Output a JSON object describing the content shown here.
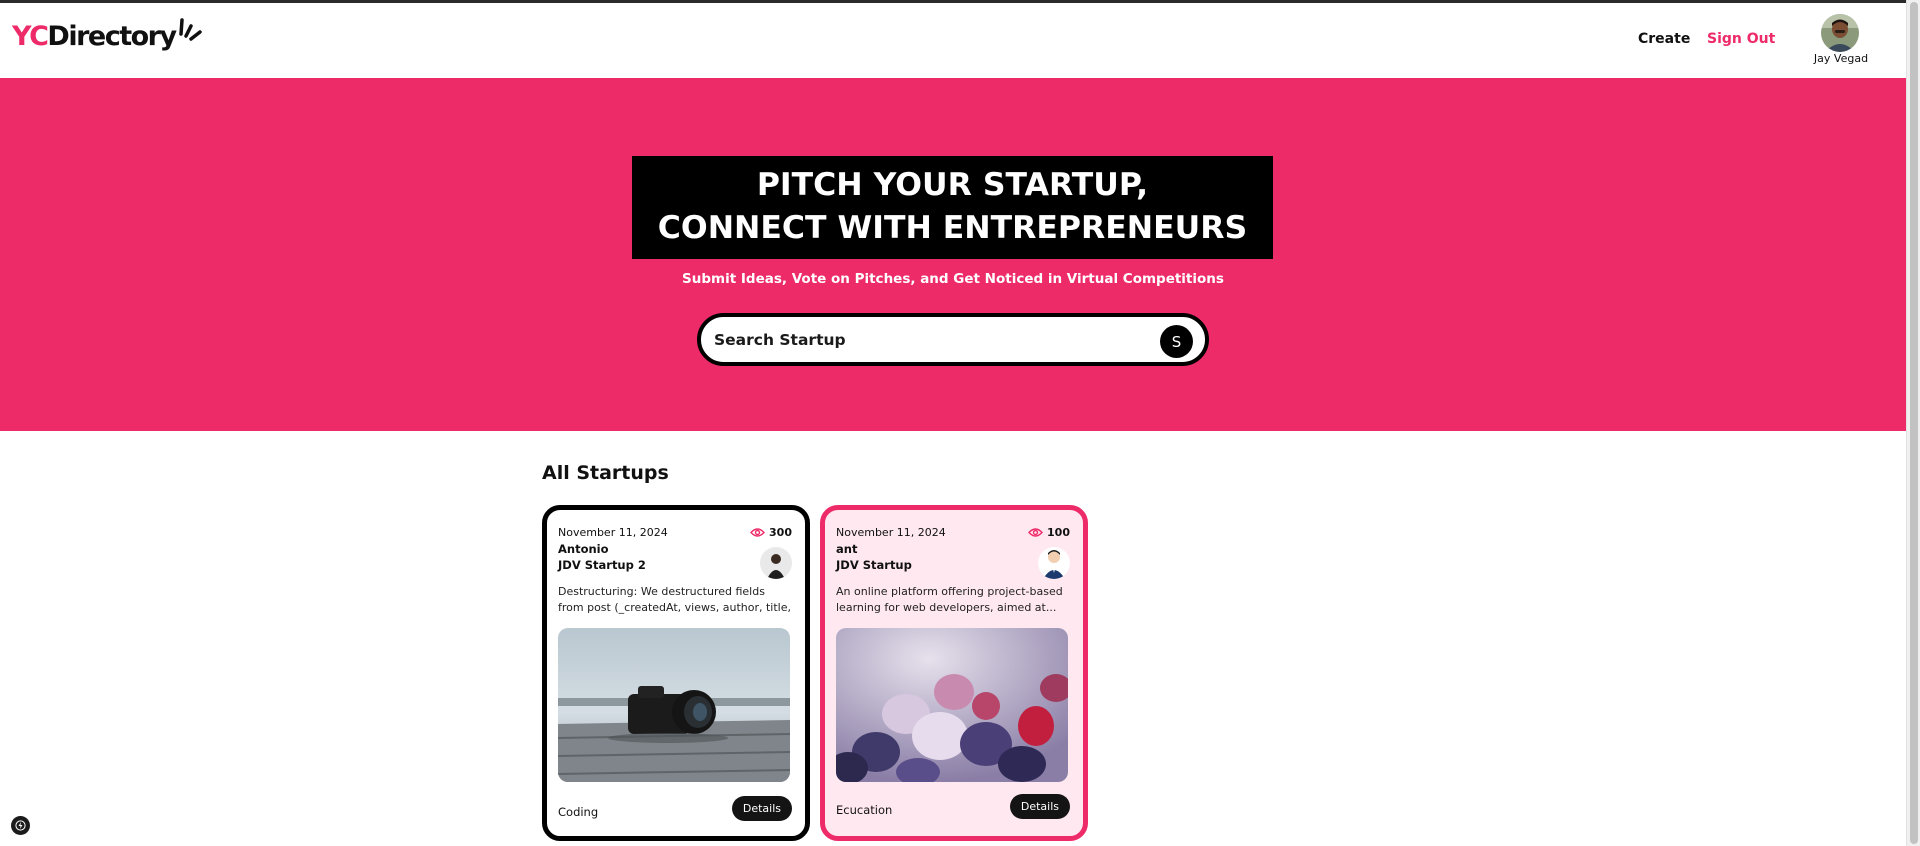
{
  "brand": {
    "part1": "YC",
    "part2": "Directory",
    "accent": "#EE2B69"
  },
  "nav": {
    "create_label": "Create",
    "signout_label": "Sign Out",
    "user_name": "Jay Vegad",
    "avatar_icon": "user-avatar-photo"
  },
  "hero": {
    "heading_line1": "PITCH YOUR STARTUP,",
    "heading_line2": "CONNECT WITH ENTREPRENEURS",
    "subheading": "Submit Ideas, Vote on Pitches, and Get Noticed in Virtual Competitions",
    "bg_color": "#EE2B69"
  },
  "search": {
    "placeholder": "Search Startup",
    "button_label": "S",
    "button_icon": "search-icon"
  },
  "section": {
    "title": "All Startups"
  },
  "cards": [
    {
      "date": "November 11, 2024",
      "views": "300",
      "author": "Antonio",
      "title": "JDV Startup 2",
      "description": "Destructuring: We destructured fields from post (_createdAt, views, author, title, _id,...",
      "category": "Coding",
      "details_label": "Details",
      "image_icon": "camera-photo",
      "style": "dark"
    },
    {
      "date": "November 11, 2024",
      "views": "100",
      "author": "ant",
      "title": "JDV Startup",
      "description": "An online platform offering project-based learning for web developers, aimed at...",
      "category": "Ecucation",
      "details_label": "Details",
      "image_icon": "frozen-berries-photo",
      "style": "pink"
    }
  ]
}
